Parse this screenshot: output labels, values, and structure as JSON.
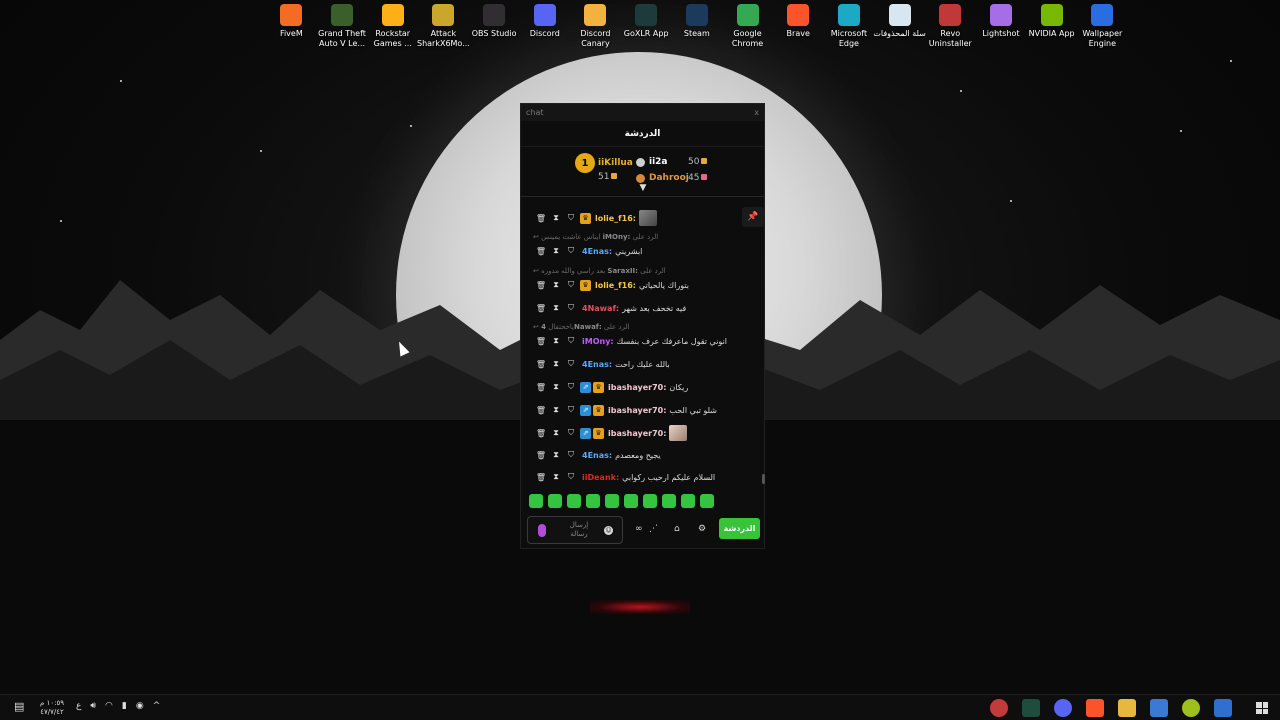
{
  "desktop_icons": [
    {
      "label": "FiveM",
      "icon": "fivem-icon",
      "color": "#f26c24"
    },
    {
      "label": "Grand Theft Auto V Le...",
      "icon": "gta-icon",
      "color": "#3b5f2a"
    },
    {
      "label": "Rockstar Games ...",
      "icon": "rockstar-icon",
      "color": "#fcaf17"
    },
    {
      "label": "Attack SharkX6Mo...",
      "icon": "mouse-icon",
      "color": "#caa62b"
    },
    {
      "label": "OBS Studio",
      "icon": "obs-icon",
      "color": "#302e31"
    },
    {
      "label": "Discord",
      "icon": "discord-icon",
      "color": "#5865f2"
    },
    {
      "label": "Discord Canary",
      "icon": "discord-canary-icon",
      "color": "#f3b13f"
    },
    {
      "label": "GoXLR App",
      "icon": "goxlr-icon",
      "color": "#1d3b3b"
    },
    {
      "label": "Steam",
      "icon": "steam-icon",
      "color": "#1b3a5c"
    },
    {
      "label": "Google Chrome",
      "icon": "chrome-icon",
      "color": "#34a853"
    },
    {
      "label": "Brave",
      "icon": "brave-icon",
      "color": "#fb542b"
    },
    {
      "label": "Microsoft Edge",
      "icon": "edge-icon",
      "color": "#1ba9c6"
    },
    {
      "label": "سلة المحذوفات",
      "icon": "recycle-bin-icon",
      "color": "#d7e6f1"
    },
    {
      "label": "Revo Uninstaller",
      "icon": "revo-icon",
      "color": "#c03838"
    },
    {
      "label": "Lightshot",
      "icon": "lightshot-icon",
      "color": "#a56ee6"
    },
    {
      "label": "NVIDIA App",
      "icon": "nvidia-icon",
      "color": "#76b900"
    },
    {
      "label": "Wallpaper Engine",
      "icon": "wallpaper-engine-icon",
      "color": "#2a6de0"
    }
  ],
  "chat_window": {
    "titlebar": "chat",
    "close_glyph": "x",
    "header": "الدردشة",
    "leaderboard": {
      "first": {
        "rank": "1",
        "name": "iiKillua",
        "score": "51"
      },
      "second": {
        "name": "ii2a",
        "score": "50"
      },
      "third": {
        "name": "Dahrooj",
        "score": "45"
      }
    },
    "messages": [
      {
        "user": "lolie_f16:",
        "text": "",
        "user_color": "#f3c64a",
        "has_crown": true,
        "has_blue": false,
        "has_image": true
      },
      {
        "reply_prefix": "الرد على",
        "reply_user": "iMOny:",
        "reply_text": "ايناس عاشت يمينس"
      },
      {
        "user": "4Enas:",
        "text": "ابشريني",
        "user_color": "#5aa8ff",
        "has_crown": false,
        "has_blue": false
      },
      {
        "reply_prefix": "الرد على",
        "reply_user": "SaraxII:",
        "reply_text": "بعد راسي والله مدوره"
      },
      {
        "user": "lolie_f16:",
        "text": "بتوراك يالحياتي",
        "user_color": "#f3c64a",
        "has_crown": true,
        "has_blue": false
      },
      {
        "user": "4Nawaf:",
        "text": "فيه تخحف بعد شهر",
        "user_color": "#e4505f",
        "has_crown": false,
        "has_blue": false
      },
      {
        "reply_prefix": "الرد على",
        "reply_user": "4Nawaf:",
        "reply_text": "ياخحتفال"
      },
      {
        "user": "iMOny:",
        "text": "انوني تقول ماعرفك عرف بنفسك",
        "user_color": "#c25bff",
        "has_crown": false,
        "has_blue": false
      },
      {
        "user": "4Enas:",
        "text": "بالله عليك راحت",
        "user_color": "#5aa8ff",
        "has_crown": false,
        "has_blue": false
      },
      {
        "user": "ibashayer70:",
        "text": "ريكان",
        "user_color": "#f0c9d0",
        "has_crown": true,
        "has_blue": true
      },
      {
        "user": "ibashayer70:",
        "text": "شلو تبي الحب",
        "user_color": "#f0c9d0",
        "has_crown": true,
        "has_blue": true
      },
      {
        "user": "ibashayer70:",
        "text": "",
        "user_color": "#f0c9d0",
        "has_crown": true,
        "has_blue": true,
        "has_image": true
      },
      {
        "user": "4Enas:",
        "text": "يجيح ومعصدم",
        "user_color": "#5aa8ff",
        "has_crown": false,
        "has_blue": false
      },
      {
        "user": "iiDeank:",
        "text": "السلام عليكم ارحيب ركوابي",
        "user_color": "#d62a2a",
        "has_crown": false,
        "has_blue": false
      }
    ],
    "input_placeholder": "إرسال رسالة",
    "chat_tab_label": "الدردشة"
  },
  "taskbar": {
    "clock_time": "١٠:٥٩ م",
    "clock_date": "٤٧/٧/٤٢",
    "lang": "ع"
  },
  "colors": {
    "accent_green": "#37c43a",
    "coin": "#e8a640"
  }
}
